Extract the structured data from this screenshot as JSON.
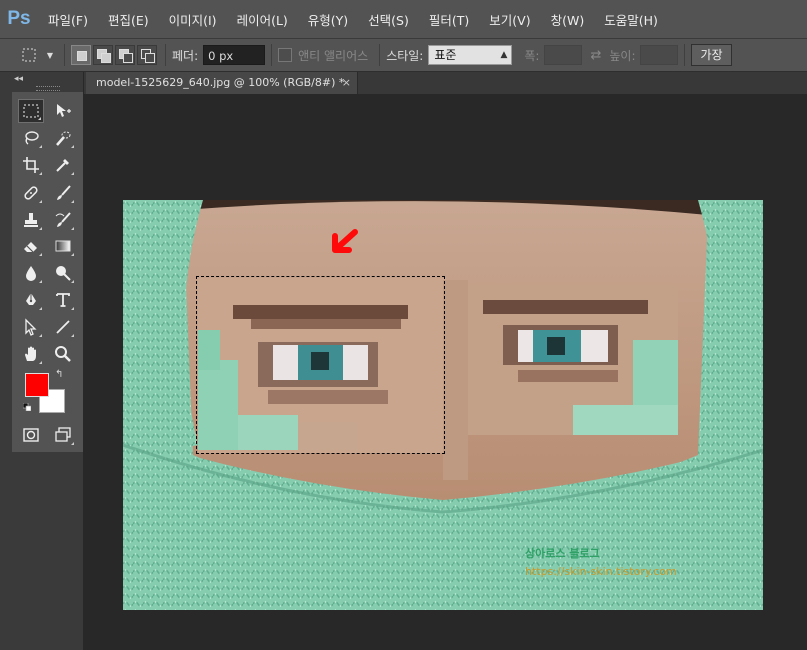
{
  "app": {
    "logo": "Ps"
  },
  "menu": [
    "파일(F)",
    "편집(E)",
    "이미지(I)",
    "레이어(L)",
    "유형(Y)",
    "선택(S)",
    "필터(T)",
    "보기(V)",
    "창(W)",
    "도움말(H)"
  ],
  "options": {
    "feather_label": "페더:",
    "feather_value": "0 px",
    "antialias_label": "앤티 앨리어스",
    "style_label": "스타일:",
    "style_value": "표준",
    "width_label": "폭:",
    "height_label": "높이:",
    "refine_label": "가장"
  },
  "document": {
    "tab_title": "model-1525629_640.jpg @ 100% (RGB/8#) *",
    "close": "×"
  },
  "watermark": {
    "line1": "상아로스 블로그",
    "line2": "https://skin-skin.tistory.com"
  },
  "colors": {
    "foreground": "#ff0000",
    "background": "#ffffff",
    "accent": "#7fb8e8"
  }
}
